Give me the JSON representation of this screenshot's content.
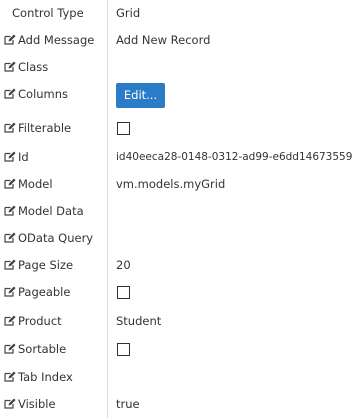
{
  "properties": {
    "control_type": {
      "label": "Control Type",
      "value": "Grid"
    },
    "add_message": {
      "label": "Add Message",
      "value": "Add New Record"
    },
    "class": {
      "label": "Class",
      "value": ""
    },
    "columns": {
      "label": "Columns",
      "button": "Edit..."
    },
    "filterable": {
      "label": "Filterable",
      "checked": false
    },
    "id": {
      "label": "Id",
      "value": "id40eeca28-0148-0312-ad99-e6dd14673559"
    },
    "model": {
      "label": "Model",
      "value": "vm.models.myGrid"
    },
    "model_data": {
      "label": "Model Data",
      "value": ""
    },
    "odata_query": {
      "label": "OData Query",
      "value": ""
    },
    "page_size": {
      "label": "Page Size",
      "value": "20"
    },
    "pageable": {
      "label": "Pageable",
      "checked": false
    },
    "product": {
      "label": "Product",
      "value": "Student"
    },
    "sortable": {
      "label": "Sortable",
      "checked": false
    },
    "tab_index": {
      "label": "Tab Index",
      "value": ""
    },
    "visible": {
      "label": "Visible",
      "value": "true"
    }
  },
  "icons": {
    "edit": "edit-icon"
  },
  "colors": {
    "button_bg": "#2a7cc7",
    "text": "#333333",
    "divider": "#dcdcdc"
  }
}
